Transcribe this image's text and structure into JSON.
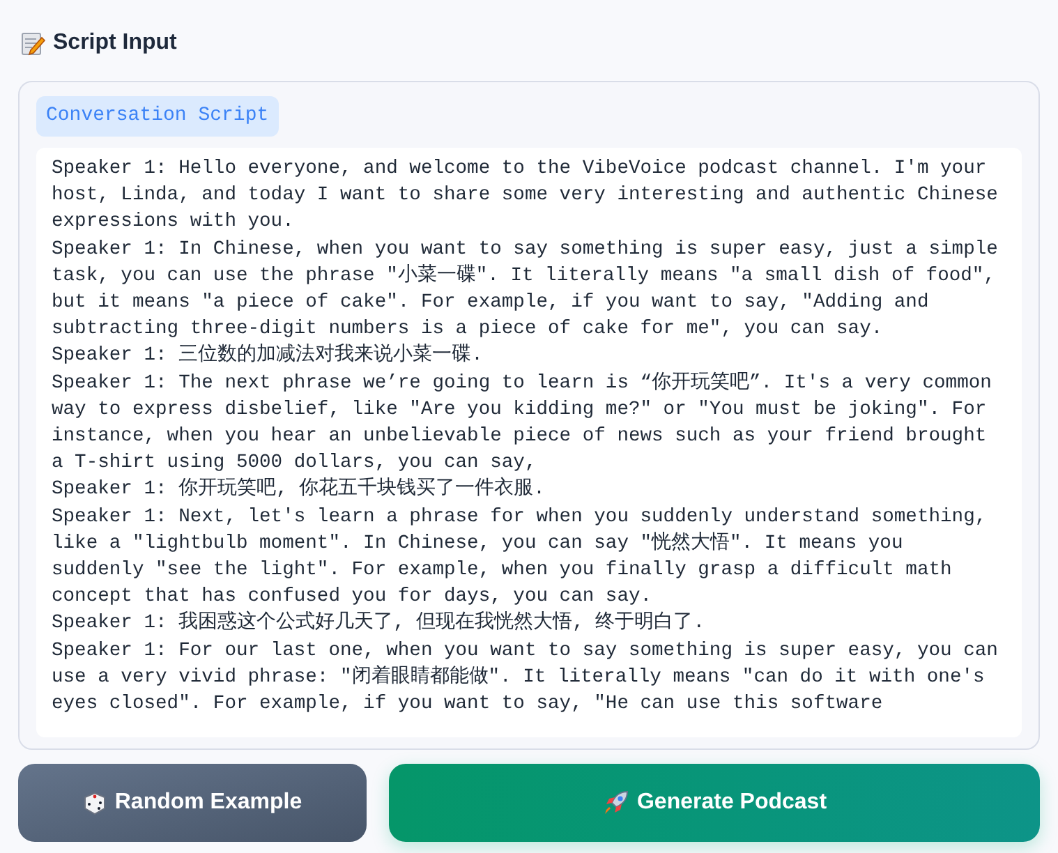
{
  "section_title": "Script Input",
  "script": {
    "label": "Conversation Script",
    "lines": [
      "Speaker 1: Hello everyone, and welcome to the VibeVoice podcast channel. I'm your host, Linda, and today I want to share some very interesting and authentic Chinese expressions with you.",
      "Speaker 1: In Chinese, when you want to say something is super easy, just a simple task, you can use the phrase \"小菜一碟\". It literally means \"a small dish of food\", but it means \"a piece of cake\". For example, if you want to say, \"Adding and subtracting three-digit numbers is a piece of cake for me\", you can say.",
      "Speaker 1: 三位数的加减法对我来说小菜一碟.",
      "Speaker 1: The next phrase we’re going to learn is “你开玩笑吧”. It's a very common way to express disbelief, like \"Are you kidding me?\" or \"You must be joking\". For instance, when you hear an unbelievable piece of news such as your friend brought a T-shirt using 5000 dollars, you can say,",
      "Speaker 1: 你开玩笑吧, 你花五千块钱买了一件衣服.",
      "Speaker 1: Next, let's learn a phrase for when you suddenly understand something, like a \"lightbulb moment\". In Chinese, you can say \"恍然大悟\". It means you suddenly \"see the light\". For example, when you finally grasp a difficult math concept that has confused you for days, you can say.",
      "Speaker 1: 我困惑这个公式好几天了, 但现在我恍然大悟, 终于明白了.",
      "Speaker 1: For our last one, when you want to say something is super easy, you can use a very vivid phrase: \"闭着眼睛都能做\". It literally means \"can do it with one's eyes closed\". For example, if you want to say, \"He can use this software"
    ]
  },
  "buttons": [
    {
      "kind": "secondary",
      "label": "Random Example"
    },
    {
      "kind": "primary",
      "label": "Generate Podcast"
    }
  ]
}
